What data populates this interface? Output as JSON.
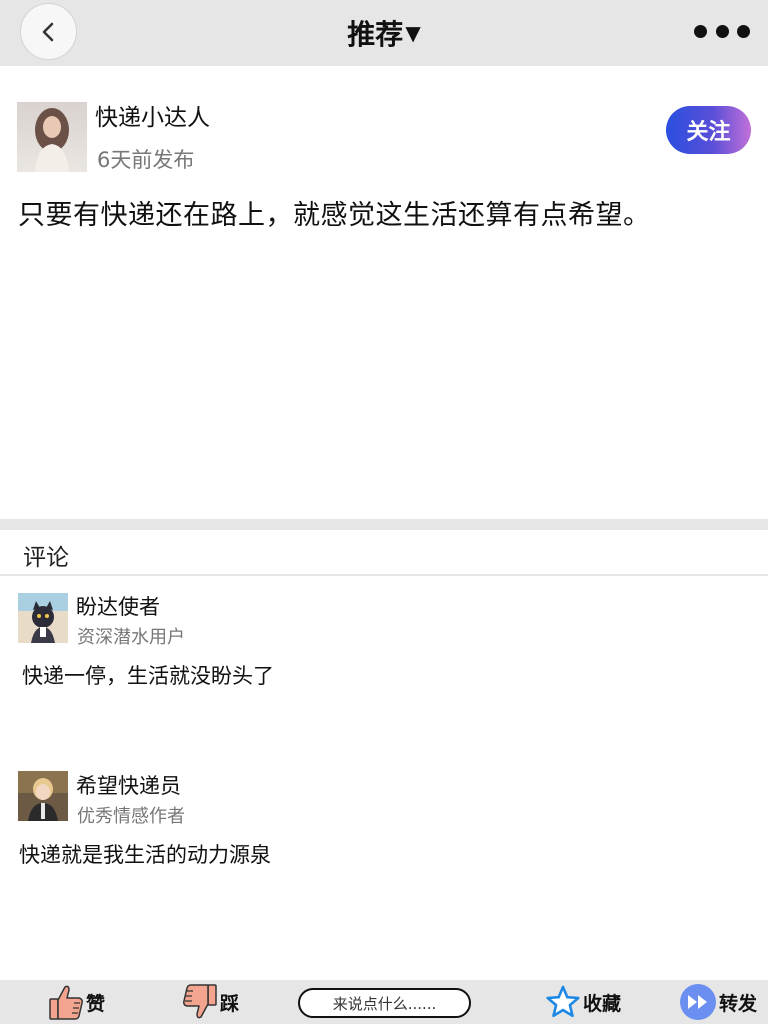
{
  "header": {
    "title": "推荐",
    "title_caret": "▼",
    "back_icon": "chevron-left-icon",
    "more_icon": "more-dots-icon"
  },
  "post": {
    "author_name": "快递小达人",
    "time": "6天前发布",
    "follow_label": "关注",
    "content": "只要有快递还在路上，就感觉这生活还算有点希望。"
  },
  "comments_section": {
    "title": "评论",
    "items": [
      {
        "name": "盼达使者",
        "badge": "资深潜水用户",
        "text": "快递一停，生活就没盼头了"
      },
      {
        "name": "希望快递员",
        "badge": "优秀情感作者",
        "text": "快递就是我生活的动力源泉"
      }
    ]
  },
  "bottombar": {
    "like_label": "赞",
    "dislike_label": "踩",
    "comment_placeholder": "来说点什么......",
    "favorite_label": "收藏",
    "share_label": "转发"
  },
  "colors": {
    "header_bg": "#e6e6e6",
    "follow_gradient_start": "#2a4fe0",
    "follow_gradient_end": "#c170d8",
    "star_blue": "#1e88e5",
    "share_circle": "#6a8ff0"
  }
}
